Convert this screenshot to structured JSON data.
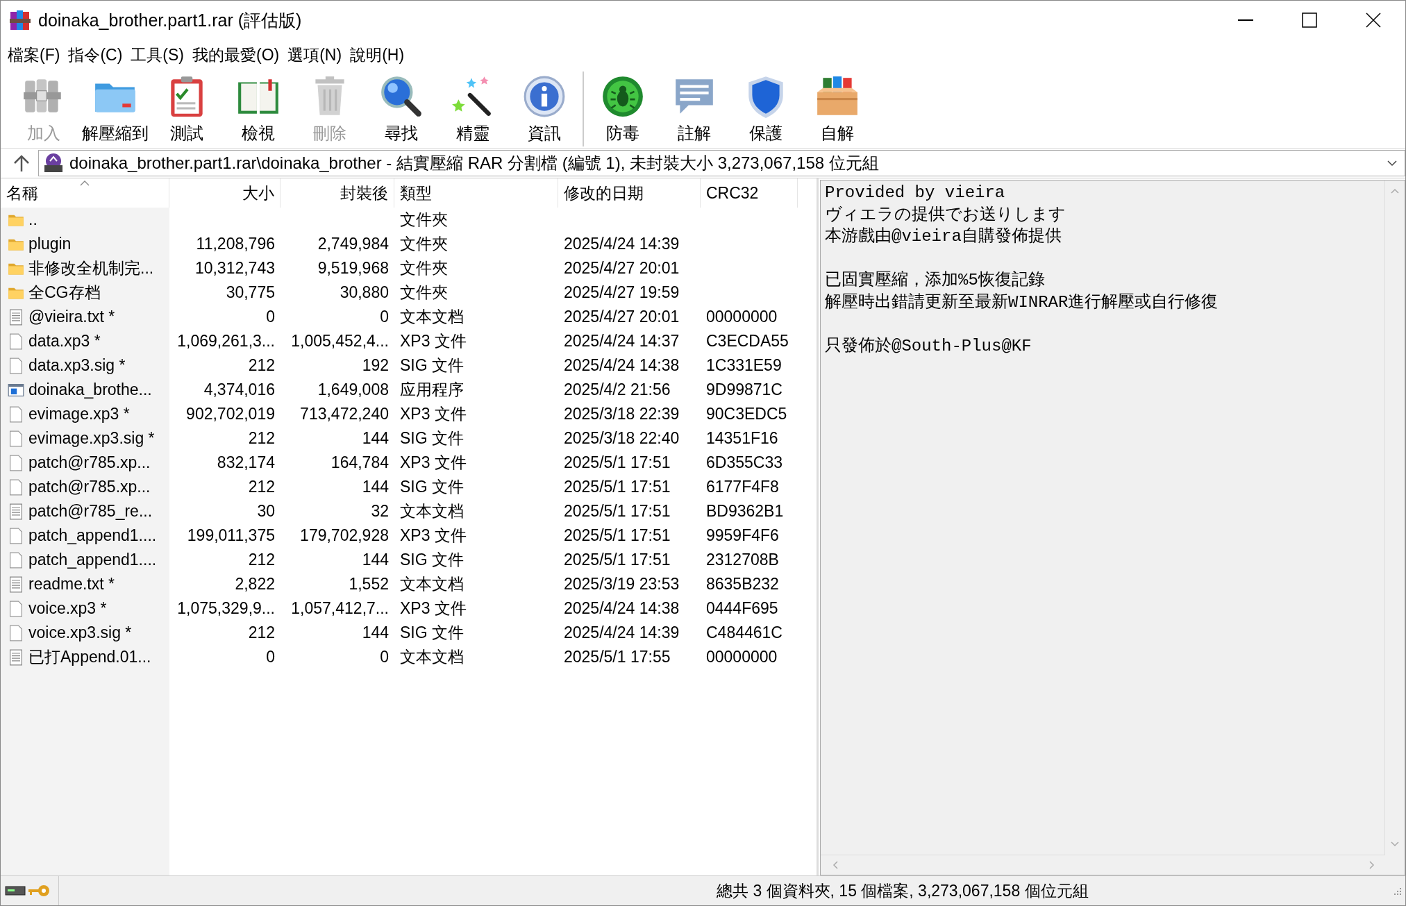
{
  "window": {
    "title": "doinaka_brother.part1.rar (評估版)"
  },
  "menu": [
    "檔案(F)",
    "指令(C)",
    "工具(S)",
    "我的最愛(O)",
    "選項(N)",
    "說明(H)"
  ],
  "toolbar": [
    {
      "label": "加入",
      "disabled": true
    },
    {
      "label": "解壓縮到",
      "disabled": false
    },
    {
      "label": "測試",
      "disabled": false
    },
    {
      "label": "檢視",
      "disabled": false
    },
    {
      "label": "刪除",
      "disabled": true
    },
    {
      "label": "尋找",
      "disabled": false
    },
    {
      "label": "精靈",
      "disabled": false
    },
    {
      "label": "資訊",
      "disabled": false
    },
    {
      "label": "防毒",
      "disabled": false
    },
    {
      "label": "註解",
      "disabled": false
    },
    {
      "label": "保護",
      "disabled": false
    },
    {
      "label": "自解",
      "disabled": false
    }
  ],
  "address": {
    "path": "doinaka_brother.part1.rar\\doinaka_brother - 結實壓縮 RAR 分割檔 (編號 1), 未封裝大小 3,273,067,158 位元組"
  },
  "table": {
    "columns": [
      {
        "label": "名稱",
        "sorted": true
      },
      {
        "label": "大小",
        "sorted": false
      },
      {
        "label": "封裝後",
        "sorted": false
      },
      {
        "label": "類型",
        "sorted": false
      },
      {
        "label": "修改的日期",
        "sorted": false
      },
      {
        "label": "CRC32",
        "sorted": false
      }
    ],
    "rows": [
      {
        "kind": "folder",
        "name": "..",
        "type": "文件夾"
      },
      {
        "kind": "folder",
        "name": "plugin",
        "size": "11,208,796",
        "packed": "2,749,984",
        "type": "文件夾",
        "modified": "2025/4/24 14:39"
      },
      {
        "kind": "folder",
        "name": "非修改全机制完...",
        "size": "10,312,743",
        "packed": "9,519,968",
        "type": "文件夾",
        "modified": "2025/4/27 20:01"
      },
      {
        "kind": "folder",
        "name": "全CG存档",
        "size": "30,775",
        "packed": "30,880",
        "type": "文件夾",
        "modified": "2025/4/27 19:59"
      },
      {
        "kind": "text",
        "name": "@vieira.txt *",
        "size": "0",
        "packed": "0",
        "type": "文本文档",
        "modified": "2025/4/27 20:01",
        "crc": "00000000"
      },
      {
        "kind": "file",
        "name": "data.xp3 *",
        "size": "1,069,261,3...",
        "packed": "1,005,452,4...",
        "type": "XP3 文件",
        "modified": "2025/4/24 14:37",
        "crc": "C3ECDA55"
      },
      {
        "kind": "file",
        "name": "data.xp3.sig *",
        "size": "212",
        "packed": "192",
        "type": "SIG 文件",
        "modified": "2025/4/24 14:38",
        "crc": "1C331E59"
      },
      {
        "kind": "app",
        "name": "doinaka_brothe...",
        "size": "4,374,016",
        "packed": "1,649,008",
        "type": "应用程序",
        "modified": "2025/4/2 21:56",
        "crc": "9D99871C"
      },
      {
        "kind": "file",
        "name": "evimage.xp3 *",
        "size": "902,702,019",
        "packed": "713,472,240",
        "type": "XP3 文件",
        "modified": "2025/3/18 22:39",
        "crc": "90C3EDC5"
      },
      {
        "kind": "file",
        "name": "evimage.xp3.sig *",
        "size": "212",
        "packed": "144",
        "type": "SIG 文件",
        "modified": "2025/3/18 22:40",
        "crc": "14351F16"
      },
      {
        "kind": "file",
        "name": "patch@r785.xp...",
        "size": "832,174",
        "packed": "164,784",
        "type": "XP3 文件",
        "modified": "2025/5/1 17:51",
        "crc": "6D355C33"
      },
      {
        "kind": "file",
        "name": "patch@r785.xp...",
        "size": "212",
        "packed": "144",
        "type": "SIG 文件",
        "modified": "2025/5/1 17:51",
        "crc": "6177F4F8"
      },
      {
        "kind": "text",
        "name": "patch@r785_re...",
        "size": "30",
        "packed": "32",
        "type": "文本文档",
        "modified": "2025/5/1 17:51",
        "crc": "BD9362B1"
      },
      {
        "kind": "file",
        "name": "patch_append1....",
        "size": "199,011,375",
        "packed": "179,702,928",
        "type": "XP3 文件",
        "modified": "2025/5/1 17:51",
        "crc": "9959F4F6"
      },
      {
        "kind": "file",
        "name": "patch_append1....",
        "size": "212",
        "packed": "144",
        "type": "SIG 文件",
        "modified": "2025/5/1 17:51",
        "crc": "2312708B"
      },
      {
        "kind": "text",
        "name": "readme.txt *",
        "size": "2,822",
        "packed": "1,552",
        "type": "文本文档",
        "modified": "2025/3/19 23:53",
        "crc": "8635B232"
      },
      {
        "kind": "file",
        "name": "voice.xp3 *",
        "size": "1,075,329,9...",
        "packed": "1,057,412,7...",
        "type": "XP3 文件",
        "modified": "2025/4/24 14:38",
        "crc": "0444F695"
      },
      {
        "kind": "file",
        "name": "voice.xp3.sig *",
        "size": "212",
        "packed": "144",
        "type": "SIG 文件",
        "modified": "2025/4/24 14:39",
        "crc": "C484461C"
      },
      {
        "kind": "text",
        "name": "已打Append.01...",
        "size": "0",
        "packed": "0",
        "type": "文本文档",
        "modified": "2025/5/1 17:55",
        "crc": "00000000"
      }
    ]
  },
  "comment": {
    "paragraphs": [
      [
        "Provided by vieira",
        "ヴィエラの提供でお送りします",
        "本游戲由@vieira自購發佈提供"
      ],
      [
        "已固實壓縮，添加%5恢復記錄",
        "解壓時出錯請更新至最新WINRAR進行解壓或自行修復"
      ],
      [
        "只發佈於@South-Plus@KF"
      ]
    ]
  },
  "status_bar": {
    "text": "總共 3 個資料夾, 15 個檔案, 3,273,067,158 個位元組"
  }
}
